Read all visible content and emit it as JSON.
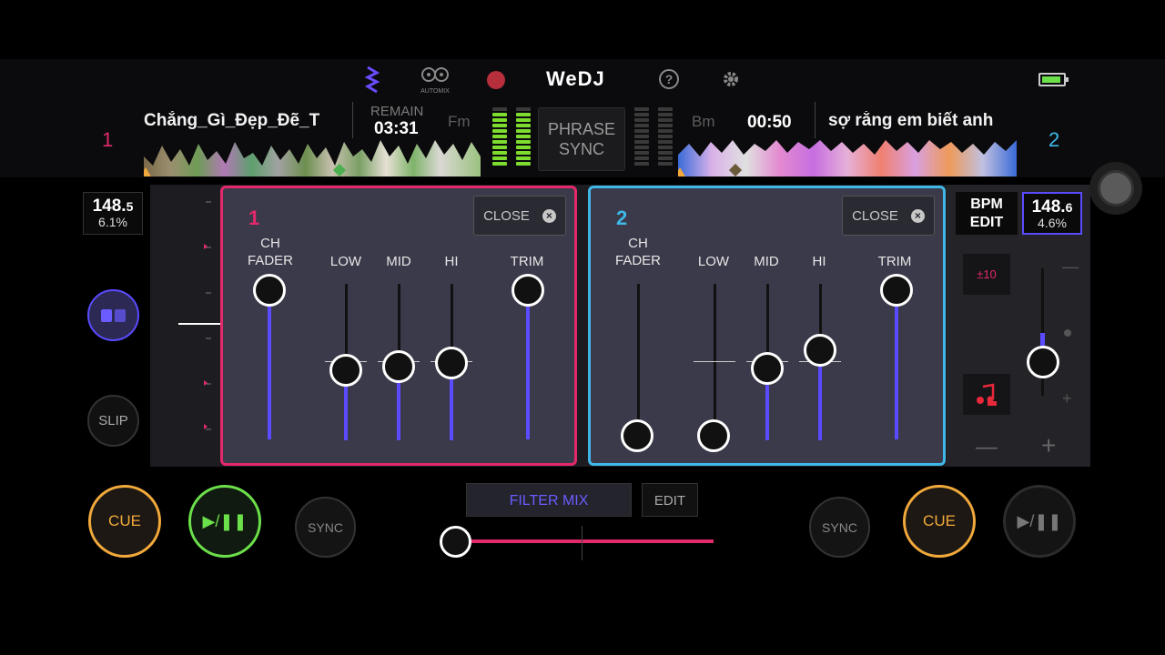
{
  "app": {
    "title": "WeDJ",
    "help_icon": "question-circle-icon",
    "settings_icon": "gear-icon",
    "automix_label": "AUTOMIX",
    "battery_icon": "battery-icon",
    "colors": {
      "deck1": "#e3296b",
      "deck2": "#3fb8e8",
      "accent": "#5b4bff",
      "cue": "#f2a93b",
      "play": "#6ce04a"
    }
  },
  "deck1": {
    "number": "1",
    "title": "Chẳng_Gì_Đẹp_Đẽ_T",
    "remain_label": "REMAIN",
    "remain_time": "03:31",
    "key": "Fm",
    "bpm_main": "148.",
    "bpm_decimal": "5",
    "pitch": "6.1%",
    "slip_label": "SLIP",
    "cue_label": "CUE",
    "play_label": "▶/❚❚",
    "sync_label": "SYNC"
  },
  "deck2": {
    "number": "2",
    "title": "sợ rằng em biết anh",
    "time": "00:50",
    "key": "Bm",
    "bpm_main": "148.",
    "bpm_decimal": "6",
    "pitch": "4.6%",
    "bpm_edit_label": "BPM\nEDIT",
    "range_label": "±10",
    "cue_label": "CUE",
    "play_label": "▶/❚❚",
    "sync_label": "SYNC",
    "minus": "—",
    "plus": "+"
  },
  "phrase_sync": "PHRASE\nSYNC",
  "mixer1": {
    "number": "1",
    "close_label": "CLOSE",
    "labels": {
      "ch_fader": "CH\nFADER",
      "low": "LOW",
      "mid": "MID",
      "hi": "HI",
      "trim": "TRIM"
    }
  },
  "mixer2": {
    "number": "2",
    "close_label": "CLOSE",
    "labels": {
      "ch_fader": "CH\nFADER",
      "low": "LOW",
      "mid": "MID",
      "hi": "HI",
      "trim": "TRIM"
    }
  },
  "filter_mix": {
    "label": "FILTER MIX",
    "edit_label": "EDIT"
  }
}
